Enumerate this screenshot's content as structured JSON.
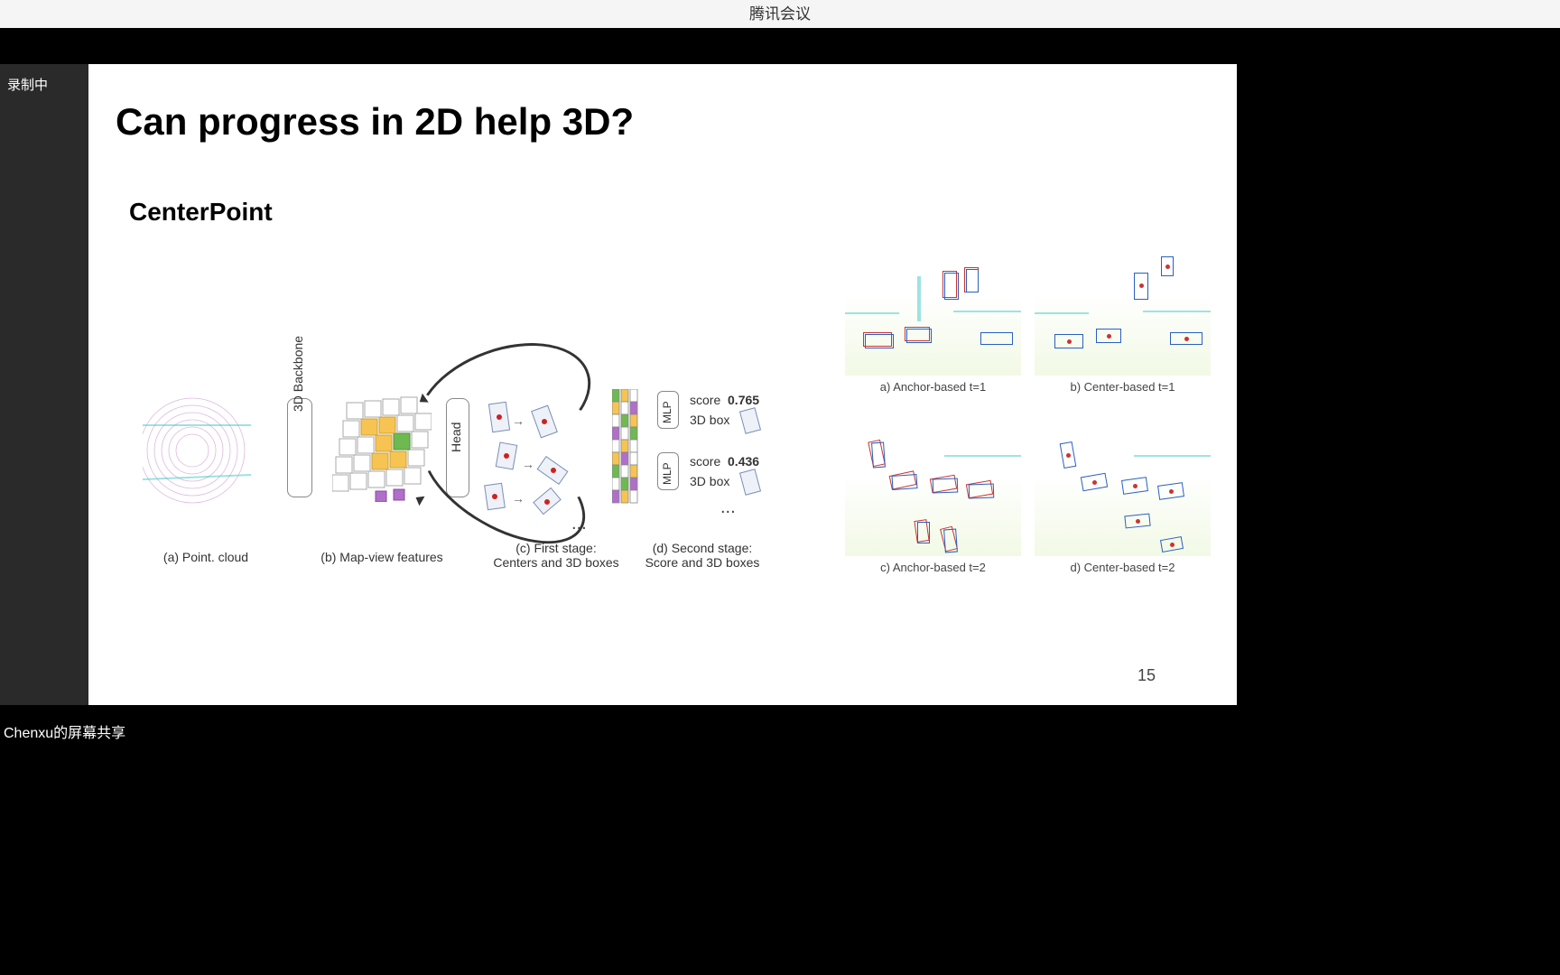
{
  "app_title": "腾讯会议",
  "recording_label": "录制中",
  "share_status": "Chenxu的屏幕共享",
  "slide": {
    "title": "Can progress in 2D help 3D?",
    "subtitle": "CenterPoint",
    "page_number": "15"
  },
  "pipeline": {
    "backbone_label": "3D Backbone",
    "head_label": "Head",
    "mlp_label": "MLP",
    "score_label": "score",
    "box_label": "3D box",
    "scores": [
      "0.765",
      "0.436"
    ],
    "ellipsis": "...",
    "captions": {
      "a": "(a) Point. cloud",
      "b": "(b) Map-view features",
      "c_line1": "(c) First stage:",
      "c_line2": "Centers and 3D boxes",
      "d_line1": "(d) Second stage:",
      "d_line2": "Score and 3D boxes"
    }
  },
  "quad_labels": {
    "a": "a) Anchor-based t=1",
    "b": "b) Center-based t=1",
    "c": "c) Anchor-based t=2",
    "d": "d) Center-based t=2"
  }
}
